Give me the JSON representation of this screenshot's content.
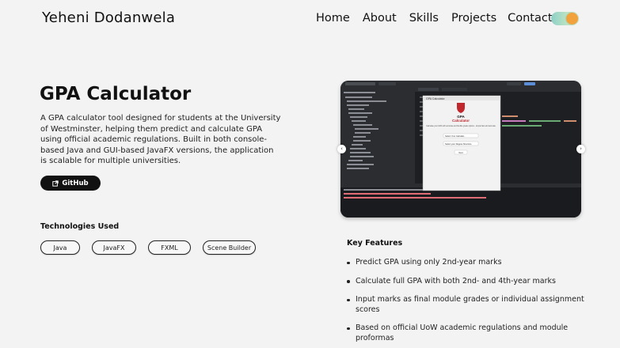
{
  "header": {
    "brand": "Yeheni Dodanwela",
    "nav": [
      "Home",
      "About",
      "Skills",
      "Projects",
      "Contact"
    ]
  },
  "project": {
    "title": "GPA Calculator",
    "description": "A GPA calculator tool designed for students at the University of Westminster, helping them predict and calculate GPA using official academic regulations. Built in both console-based Java and GUI-based JavaFX versions, the application is scalable for multiple universities.",
    "github_label": "GitHub",
    "tech_title": "Technologies Used",
    "technologies": [
      "Java",
      "JavaFX",
      "FXML",
      "Scene Builder"
    ],
    "features_title": "Key Features",
    "features": [
      "Predict GPA using only 2nd-year marks",
      "Calculate full GPA with both 2nd- and 4th-year marks",
      "Input marks as final module grades or individual assignment scores",
      "Based on official UoW academic regulations and module proformas"
    ]
  },
  "screenshot": {
    "window_title": "GPA Calculator",
    "heading_line1": "GPA",
    "heading_line2": "Calculator",
    "subtext": "Calculate your GPA with accurate and flexible grade options - simple fast and accurate",
    "select1": "Select Your Calculati...",
    "select2": "Select your Degree Structure",
    "next_label": "Next"
  },
  "colors": {
    "accent": "#c0282d",
    "background": "#f3f3f3",
    "button": "#111111",
    "toggle_knob": "#f2a23c"
  },
  "icons": {
    "github": "external-link-icon",
    "carousel_prev": "chevron-left-icon",
    "carousel_next": "chevron-right-icon"
  }
}
